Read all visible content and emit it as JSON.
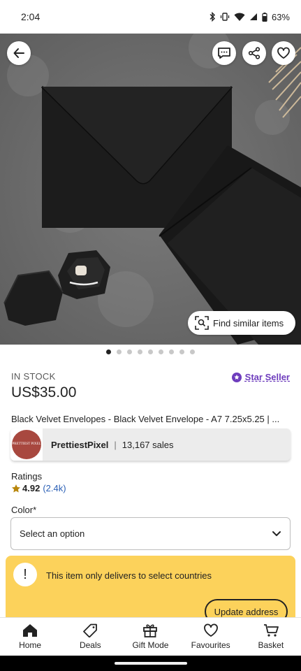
{
  "status_bar": {
    "time": "2:04",
    "battery": "63%"
  },
  "hero": {
    "find_similar_label": "Find similar items",
    "image_count": 9,
    "active_index": 0
  },
  "product": {
    "stock": "IN STOCK",
    "star_seller": "Star Seller",
    "price": "US$35.00",
    "title": "Black Velvet Envelopes - Black Velvet Envelope - A7 7.25x5.25 | ..."
  },
  "shop": {
    "logo_text": "PRETTIEST PIXEL",
    "name": "PrettiestPixel",
    "separator": "|",
    "sales": "13,167 sales"
  },
  "ratings": {
    "label": "Ratings",
    "score": "4.92",
    "count": "(2.4k)"
  },
  "color": {
    "label": "Color*",
    "selected": "Select an option"
  },
  "notice": {
    "message": "This item only delivers to select countries",
    "button": "Update address"
  },
  "bottom_nav": [
    {
      "label": "Home",
      "icon": "home-icon"
    },
    {
      "label": "Deals",
      "icon": "tag-icon"
    },
    {
      "label": "Gift Mode",
      "icon": "gift-icon"
    },
    {
      "label": "Favourites",
      "icon": "heart-icon"
    },
    {
      "label": "Basket",
      "icon": "basket-icon"
    }
  ],
  "colors": {
    "star_seller": "#6e3dbd",
    "notice_bg": "#fcd25b",
    "link": "#2a5fb5",
    "star": "#b8860b"
  }
}
